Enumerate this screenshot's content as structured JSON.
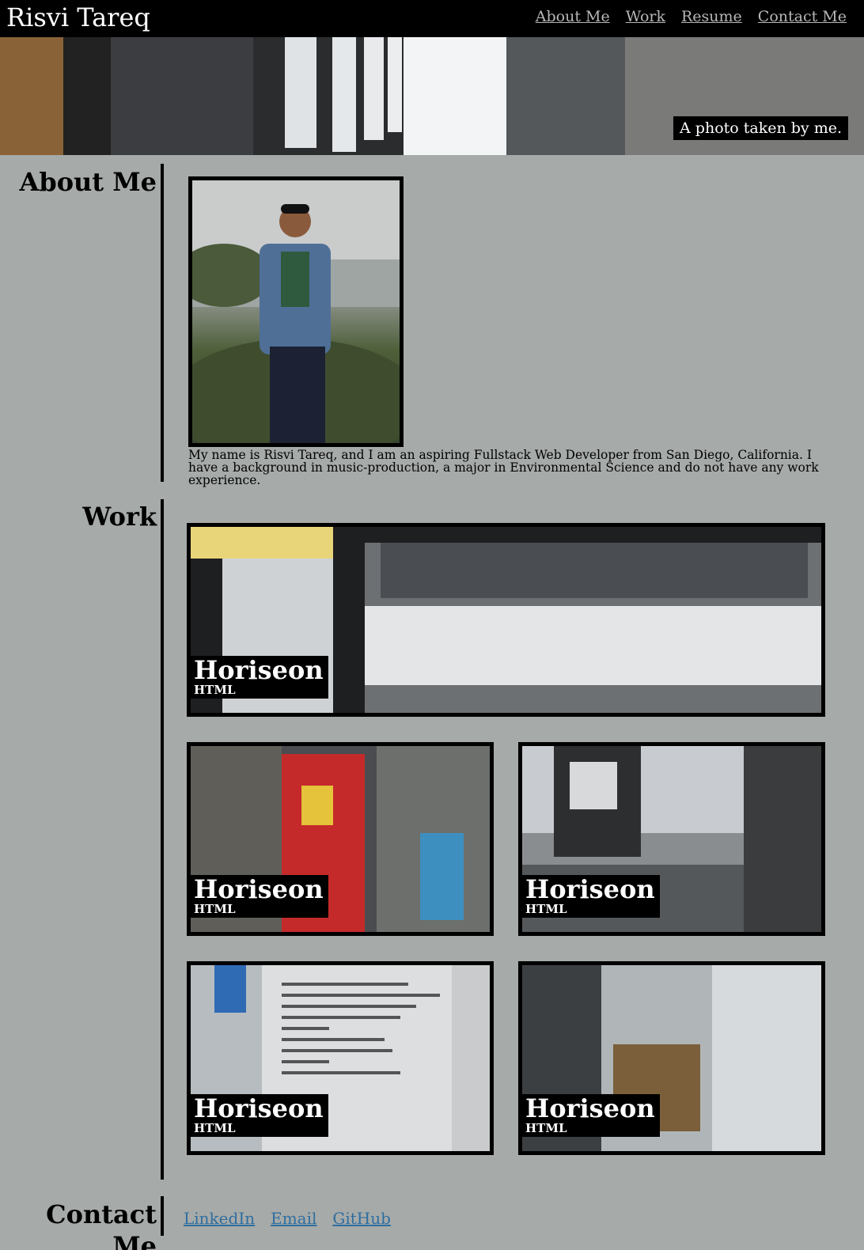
{
  "header": {
    "title": "Risvi Tareq",
    "nav": [
      "About Me",
      "Work",
      "Resume",
      "Contact Me"
    ]
  },
  "hero": {
    "caption": "A photo taken by me."
  },
  "about": {
    "heading": "About Me",
    "text": "My name is Risvi Tareq, and I am an aspiring Fullstack Web Developer from San Diego, California. I have a background in music-production, a major in Environmental Science and do not have any work experience."
  },
  "work": {
    "heading": "Work",
    "cards": [
      {
        "title": "Horiseon",
        "subtitle": "HTML"
      },
      {
        "title": "Horiseon",
        "subtitle": "HTML"
      },
      {
        "title": "Horiseon",
        "subtitle": "HTML"
      },
      {
        "title": "Horiseon",
        "subtitle": "HTML"
      },
      {
        "title": "Horiseon",
        "subtitle": "HTML"
      }
    ]
  },
  "contact": {
    "heading": "Contact Me",
    "links": [
      "LinkedIn",
      "Email",
      "GitHub"
    ]
  },
  "colors": {
    "page_bg": "#a6aaa8",
    "header_bg": "#000000",
    "nav_link": "#b7b7b7",
    "contact_link": "#2e6ea0"
  }
}
